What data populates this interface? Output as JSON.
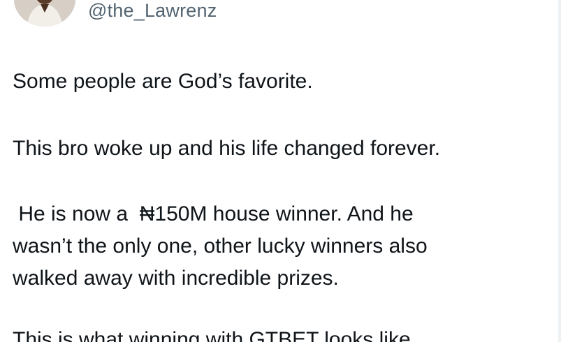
{
  "author": {
    "handle": "@the_Lawrenz",
    "avatar_icon": "profile-photo-icon"
  },
  "tweet": {
    "paragraph_1": "Some people are God’s favorite.",
    "paragraph_2": "This bro woke up and his life changed forever.",
    "paragraph_3_line_1": " He is now a  ₦150M house winner. And he",
    "paragraph_3_line_2": "wasn’t the only one, other lucky winners also",
    "paragraph_3_line_3": "walked away with incredible prizes.",
    "paragraph_4_partial": "This is what winning with GTBET looks like"
  },
  "colors": {
    "text_primary": "#0f1419",
    "text_secondary": "#536471",
    "background": "#ffffff"
  }
}
